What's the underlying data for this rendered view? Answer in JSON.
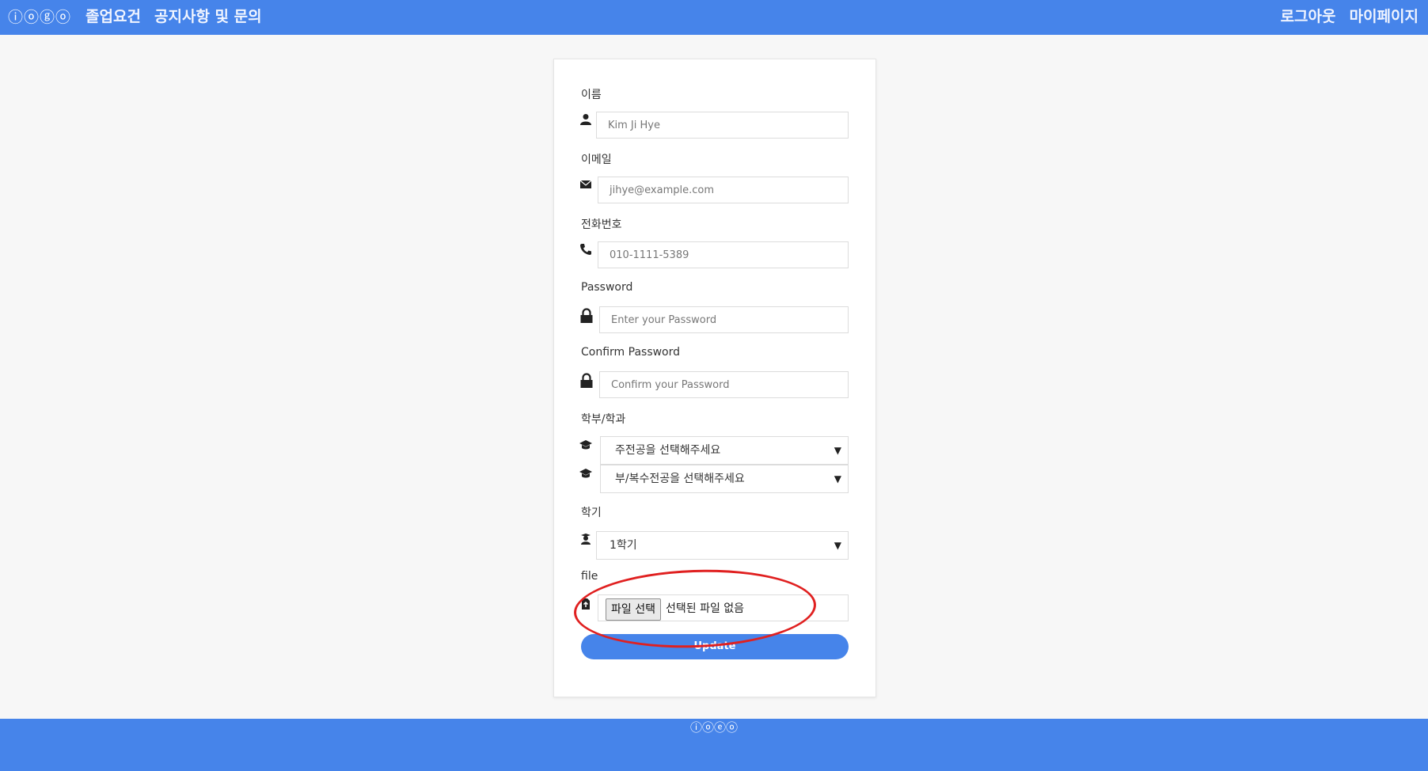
{
  "header": {
    "logo": "ⓘⓞⓖⓞ",
    "nav_left": [
      "졸업요건",
      "공지사항 및 문의"
    ],
    "nav_right": [
      "로그아웃",
      "마이페이지"
    ]
  },
  "form": {
    "name_label": "이름",
    "name_placeholder": "Kim Ji Hye",
    "email_label": "이메일",
    "email_placeholder": "jihye@example.com",
    "phone_label": "전화번호",
    "phone_placeholder": "010-1111-5389",
    "password_label": "Password",
    "password_placeholder": "Enter your Password",
    "confirm_label": "Confirm Password",
    "confirm_placeholder": "Confirm your Password",
    "dept_label": "학부/학과",
    "major_select": "주전공을 선택해주세요",
    "minor_select": "부/복수전공을 선택해주세요",
    "semester_label": "학기",
    "semester_select": "1학기",
    "file_label": "file",
    "file_button": "파일 선택",
    "file_status": "선택된 파일 없음",
    "submit_label": "Update"
  },
  "footer": {
    "logo": "ⓘⓞⓔⓞ"
  },
  "colors": {
    "primary": "#4684ea",
    "highlight": "#e02020"
  },
  "icons": [
    "user-icon",
    "envelope-icon",
    "phone-icon",
    "lock-icon",
    "graduation-cap-icon",
    "student-icon",
    "file-upload-icon"
  ]
}
